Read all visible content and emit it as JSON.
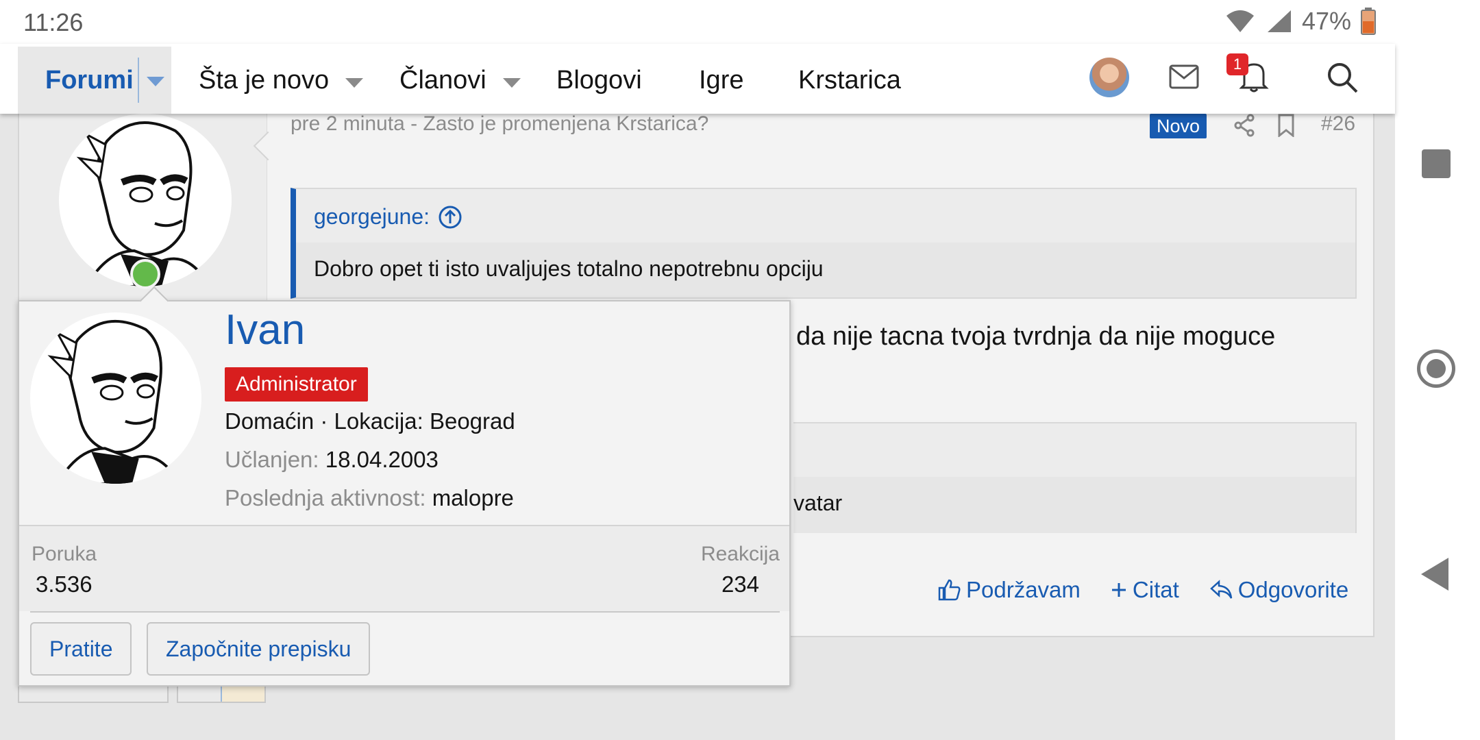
{
  "status_bar": {
    "time": "11:26",
    "battery": "47%"
  },
  "nav": {
    "items": [
      {
        "label": "Forumi",
        "active": true,
        "has_dropdown": true
      },
      {
        "label": "Šta je novo",
        "has_dropdown": true
      },
      {
        "label": "Članovi",
        "has_dropdown": true
      },
      {
        "label": "Blogovi"
      },
      {
        "label": "Igre"
      },
      {
        "label": "Krstarica"
      }
    ],
    "notification_count": "1",
    "icons": [
      "user-avatar",
      "mail-icon",
      "bell-icon",
      "search-icon"
    ]
  },
  "post": {
    "header": "pre 2 minuta - Zasto je promenjena Krstarica?",
    "badge": "Novo",
    "number": "#26",
    "quote": {
      "author": "georgejune:",
      "text": "Dobro opet ti isto uvaljujes totalno nepotrebnu opciju"
    },
    "text": "da nije tacna tvoja tvrdnja da nije moguce",
    "quote2_text": "vatar",
    "actions": {
      "like": "Podržavam",
      "quote": "Citat",
      "reply": "Odgovorite"
    }
  },
  "popup": {
    "name": "Ivan",
    "role": "Administrator",
    "line1": "Domaćin · Lokacija: Beograd",
    "joined_label": "Učlanjen:",
    "joined_value": "18.04.2003",
    "last_activity_label": "Poslednja aktivnost:",
    "last_activity_value": "malopre",
    "messages_label": "Poruka",
    "messages_value": "3.536",
    "reactions_label": "Reakcija",
    "reactions_value": "234",
    "follow_button": "Pratite",
    "message_button": "Započnite prepisku"
  },
  "colors": {
    "accent": "#185bb1",
    "role_badge": "#d81e1e",
    "online": "#63b94a",
    "notification": "#e0262a"
  }
}
